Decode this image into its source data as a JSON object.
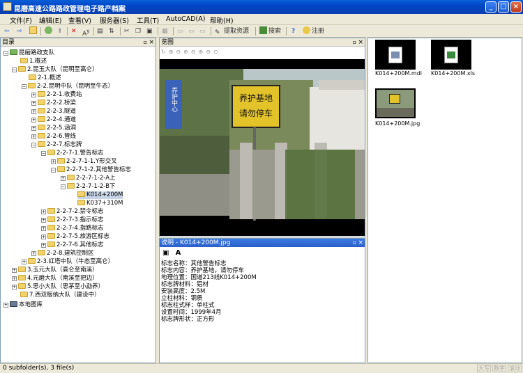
{
  "window": {
    "title": "昆磨高速公路路政管理电子路产档案",
    "min": "_",
    "max": "□",
    "close": "×"
  },
  "menu": [
    "文件(F)",
    "编辑(E)",
    "查看(V)",
    "服务器(S)",
    "工具(T)",
    "AutoCAD(A)",
    "帮助(H)"
  ],
  "toolbar": {
    "extract": "提取资源",
    "search": "搜索",
    "register": "注册"
  },
  "tree": {
    "title": "目录",
    "nodes": [
      "昆磨路政支队",
      "1.概述",
      "2.昆玉大队（昆明至高仑）",
      "2-1.概述",
      "2-2.昆明中队（昆明至牛态）",
      "2-2-1.收费站",
      "2-2-2.桥梁",
      "2-2-3.隧道",
      "2-2-4.通道",
      "2-2-5.涵洞",
      "2-2-6.管线",
      "2-2-7.标志牌",
      "2-2-7-1.警告标志",
      "2-2-7-1-1.Y形交叉",
      "2-2-7-1-2.其他警告标志",
      "2-2-7-1-2-A上",
      "2-2-7-1-2-B下",
      "K014+200M",
      "K037+310M",
      "2-2-7-2.禁令标志",
      "2-2-7-3.指示标志",
      "2-2-7-4.指路标志",
      "2-2-7-5.旅游区标志",
      "2-2-7-6.其他标志",
      "2-2-8.建筑控制区",
      "2-3.红塔中队（牛态至高仑）",
      "3.玉元大队（高仑至南溪）",
      "4.元磨大队（南溪至把边）",
      "5.思小大队（思茅至小勐养）",
      "7.西双版纳大队（建设中）",
      "本地图库"
    ]
  },
  "preview": {
    "title": "览图",
    "sign_line1": "养护基地",
    "sign_line2": "请勿停车",
    "blue_sign": "养护中心"
  },
  "description": {
    "title": "说明 - K014+200M.jpg",
    "lines": [
      "标志名称：其他警告标志",
      "标志内容：养护基地，请勿停车",
      "地理位置：国道213线K014+200M",
      "标志牌材料：铝材",
      "安装高度：2.5M",
      "立柱材料：钢质",
      "标志柱式样：单柱式",
      "设置时间：1999年4月",
      "标志牌形状：正方形"
    ]
  },
  "files": [
    {
      "name": "K014+200M.mdi"
    },
    {
      "name": "K014+200M.xls"
    },
    {
      "name": "K014+200M.jpg"
    }
  ],
  "status": {
    "text": "0 subfolder(s), 3 file(s)",
    "caps": "大写",
    "num": "数字",
    "scroll": "滚动"
  }
}
